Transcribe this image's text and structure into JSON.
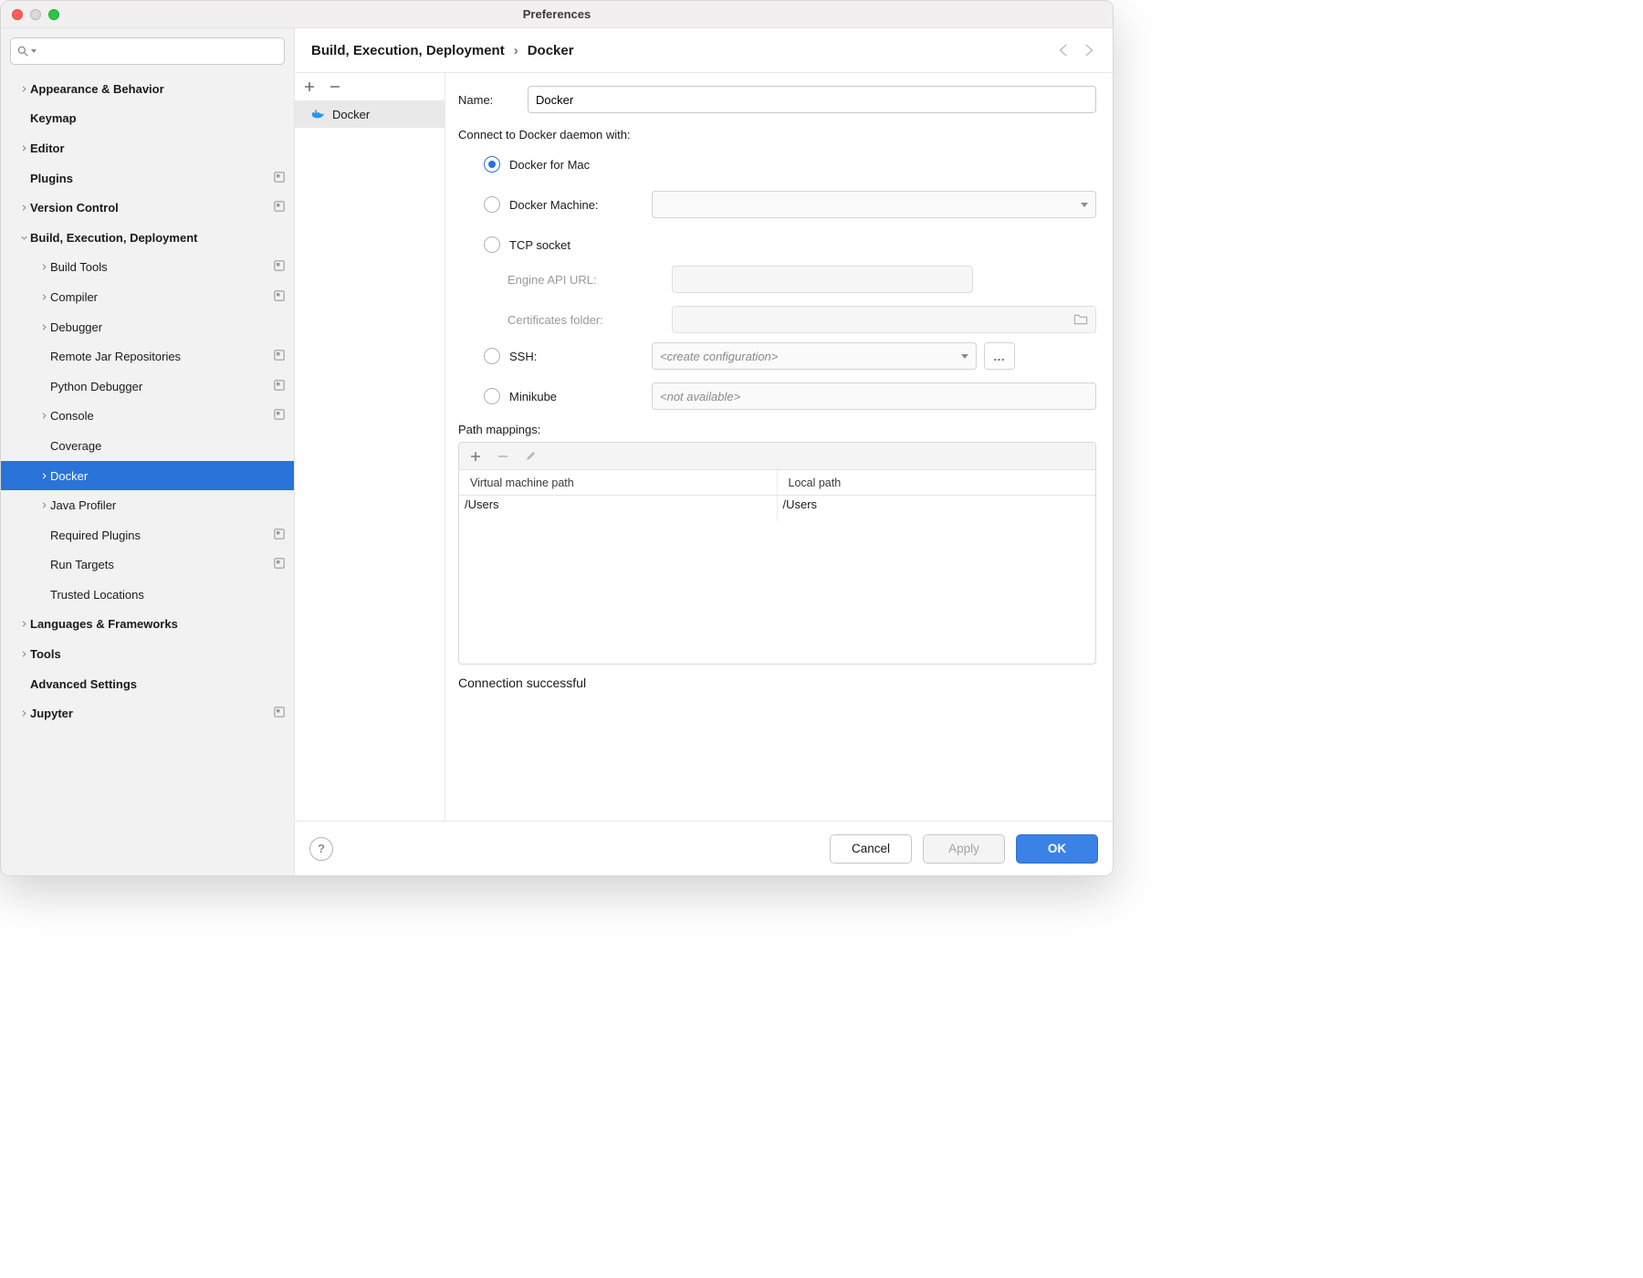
{
  "window": {
    "title": "Preferences"
  },
  "sidebar": {
    "search_placeholder": "",
    "items": [
      {
        "label": "Appearance & Behavior",
        "bold": true,
        "chev": true,
        "indent": 0,
        "scope": false
      },
      {
        "label": "Keymap",
        "bold": true,
        "chev": false,
        "indent": 0,
        "scope": false
      },
      {
        "label": "Editor",
        "bold": true,
        "chev": true,
        "indent": 0,
        "scope": false
      },
      {
        "label": "Plugins",
        "bold": true,
        "chev": false,
        "indent": 0,
        "scope": true
      },
      {
        "label": "Version Control",
        "bold": true,
        "chev": true,
        "indent": 0,
        "scope": true
      },
      {
        "label": "Build, Execution, Deployment",
        "bold": true,
        "chev": true,
        "expanded": true,
        "indent": 0,
        "scope": false
      },
      {
        "label": "Build Tools",
        "bold": false,
        "chev": true,
        "indent": 1,
        "scope": true
      },
      {
        "label": "Compiler",
        "bold": false,
        "chev": true,
        "indent": 1,
        "scope": true
      },
      {
        "label": "Debugger",
        "bold": false,
        "chev": true,
        "indent": 1,
        "scope": false
      },
      {
        "label": "Remote Jar Repositories",
        "bold": false,
        "chev": false,
        "indent": 1,
        "scope": true
      },
      {
        "label": "Python Debugger",
        "bold": false,
        "chev": false,
        "indent": 1,
        "scope": true
      },
      {
        "label": "Console",
        "bold": false,
        "chev": true,
        "indent": 1,
        "scope": true
      },
      {
        "label": "Coverage",
        "bold": false,
        "chev": false,
        "indent": 1,
        "scope": false
      },
      {
        "label": "Docker",
        "bold": false,
        "chev": true,
        "indent": 1,
        "scope": false,
        "selected": true
      },
      {
        "label": "Java Profiler",
        "bold": false,
        "chev": true,
        "indent": 1,
        "scope": false
      },
      {
        "label": "Required Plugins",
        "bold": false,
        "chev": false,
        "indent": 1,
        "scope": true
      },
      {
        "label": "Run Targets",
        "bold": false,
        "chev": false,
        "indent": 1,
        "scope": true
      },
      {
        "label": "Trusted Locations",
        "bold": false,
        "chev": false,
        "indent": 1,
        "scope": false
      },
      {
        "label": "Languages & Frameworks",
        "bold": true,
        "chev": true,
        "indent": 0,
        "scope": false
      },
      {
        "label": "Tools",
        "bold": true,
        "chev": true,
        "indent": 0,
        "scope": false
      },
      {
        "label": "Advanced Settings",
        "bold": true,
        "chev": false,
        "indent": 0,
        "scope": false
      },
      {
        "label": "Jupyter",
        "bold": true,
        "chev": true,
        "indent": 0,
        "scope": true
      }
    ]
  },
  "breadcrumb": {
    "parent": "Build, Execution, Deployment",
    "child": "Docker"
  },
  "midlist": {
    "items": [
      {
        "label": "Docker"
      }
    ]
  },
  "form": {
    "name_label": "Name:",
    "name_value": "Docker",
    "connect_title": "Connect to Docker daemon with:",
    "options": {
      "mac": "Docker for Mac",
      "machine": "Docker Machine:",
      "tcp": "TCP socket",
      "engine_url": "Engine API URL:",
      "certs": "Certificates folder:",
      "ssh": "SSH:",
      "ssh_placeholder": "<create configuration>",
      "minikube": "Minikube",
      "minikube_placeholder": "<not available>"
    },
    "path_title": "Path mappings:",
    "table": {
      "col1": "Virtual machine path",
      "col2": "Local path",
      "rows": [
        {
          "vm": "/Users",
          "local": "/Users"
        }
      ]
    },
    "status": "Connection successful"
  },
  "footer": {
    "cancel": "Cancel",
    "apply": "Apply",
    "ok": "OK"
  }
}
